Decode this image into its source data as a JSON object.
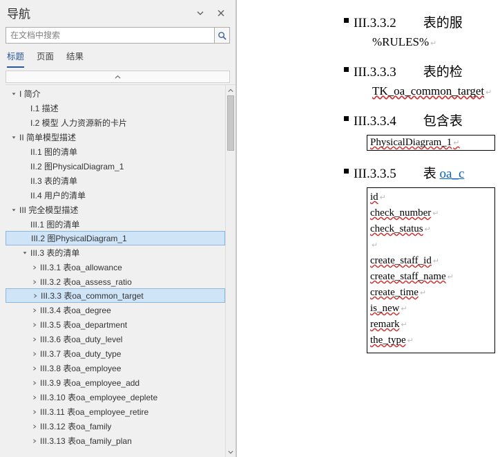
{
  "nav": {
    "title": "导航",
    "search_placeholder": "在文档中搜索",
    "tabs": {
      "headings": "标题",
      "pages": "页面",
      "results": "结果"
    }
  },
  "tree": [
    {
      "lvl": 1,
      "caret": "down",
      "label": "I 简介"
    },
    {
      "lvl": 2,
      "caret": "none",
      "label": "I.1 描述"
    },
    {
      "lvl": 2,
      "caret": "none",
      "label": "I.2 模型  人力资源新的卡片"
    },
    {
      "lvl": 1,
      "caret": "down",
      "label": "II 简单模型描述"
    },
    {
      "lvl": 2,
      "caret": "none",
      "label": "II.1 图的清单"
    },
    {
      "lvl": 2,
      "caret": "none",
      "label": "II.2 图PhysicalDiagram_1"
    },
    {
      "lvl": 2,
      "caret": "none",
      "label": "II.3 表的清单"
    },
    {
      "lvl": 2,
      "caret": "none",
      "label": "II.4 用户的清单"
    },
    {
      "lvl": 1,
      "caret": "down",
      "label": "III 完全模型描述"
    },
    {
      "lvl": 2,
      "caret": "none",
      "label": "III.1 图的清单"
    },
    {
      "lvl": 2,
      "caret": "none",
      "label": "III.2 图PhysicalDiagram_1",
      "hl": true
    },
    {
      "lvl": 2,
      "caret": "down",
      "label": "III.3 表的清单"
    },
    {
      "lvl": 3,
      "caret": "right",
      "label": "III.3.1 表oa_allowance"
    },
    {
      "lvl": 3,
      "caret": "right",
      "label": "III.3.2 表oa_assess_ratio"
    },
    {
      "lvl": 3,
      "caret": "right",
      "label": "III.3.3 表oa_common_target",
      "hl": true
    },
    {
      "lvl": 3,
      "caret": "right",
      "label": "III.3.4 表oa_degree"
    },
    {
      "lvl": 3,
      "caret": "right",
      "label": "III.3.5 表oa_department"
    },
    {
      "lvl": 3,
      "caret": "right",
      "label": "III.3.6 表oa_duty_level"
    },
    {
      "lvl": 3,
      "caret": "right",
      "label": "III.3.7 表oa_duty_type"
    },
    {
      "lvl": 3,
      "caret": "right",
      "label": "III.3.8 表oa_employee"
    },
    {
      "lvl": 3,
      "caret": "right",
      "label": "III.3.9 表oa_employee_add"
    },
    {
      "lvl": 3,
      "caret": "right",
      "label": "III.3.10 表oa_employee_deplete"
    },
    {
      "lvl": 3,
      "caret": "right",
      "label": "III.3.11 表oa_employee_retire"
    },
    {
      "lvl": 3,
      "caret": "right",
      "label": "III.3.12 表oa_family"
    },
    {
      "lvl": 3,
      "caret": "right",
      "label": "III.3.13 表oa_family_plan"
    }
  ],
  "doc": {
    "s332": {
      "num": "III.3.3.2",
      "title": "表的服",
      "body": "%RULES%"
    },
    "s333": {
      "num": "III.3.3.3",
      "title": "表的检",
      "body": "TK_oa_common_target"
    },
    "s334": {
      "num": "III.3.3.4",
      "title": "包含表",
      "cell": "PhysicalDiagram_1"
    },
    "s335": {
      "num": "III.3.3.5",
      "title_pre": "表 ",
      "title_link": "oa_c"
    },
    "fields": [
      "id",
      "check_number",
      "check_status",
      "",
      "create_staff_id",
      "create_staff_name",
      "create_time",
      "is_new",
      "remark",
      "the_type"
    ]
  }
}
